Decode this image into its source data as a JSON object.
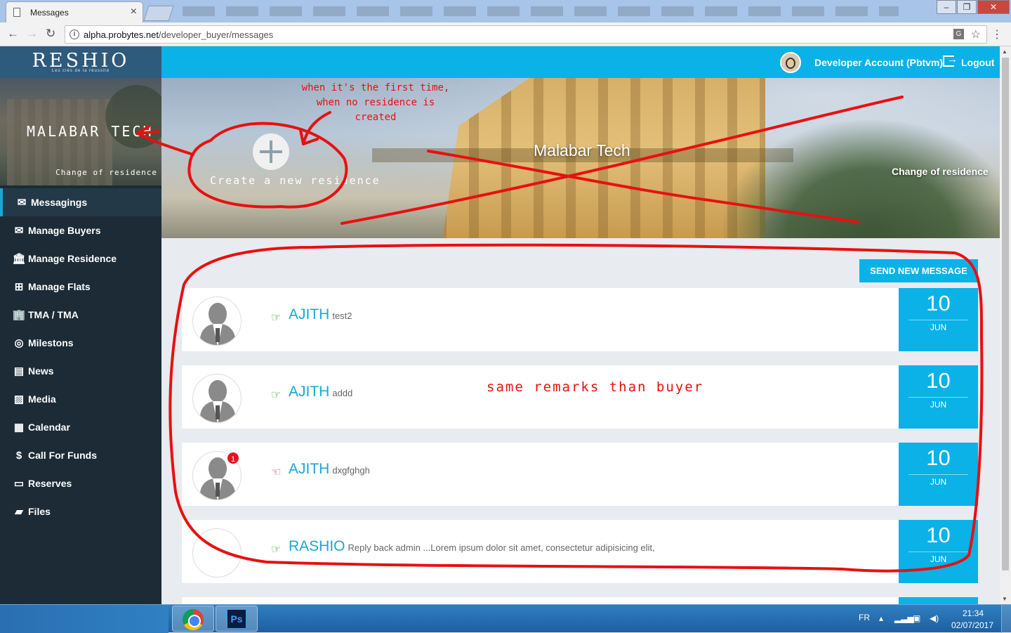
{
  "browser": {
    "tab_title": "Messages",
    "tab_close": "×",
    "url_domain": "alpha.probytes.net",
    "url_path": "/developer_buyer/messages",
    "win_minimize": "–",
    "win_restore": "❐",
    "win_close": "✕",
    "back": "←",
    "forward": "→",
    "reload": "↻",
    "star": "☆",
    "menu": "⋮",
    "translate": "G"
  },
  "sidebar": {
    "logo": "RESHIO",
    "tagline": "Les clés de la réussite",
    "residence_name": "MALABAR TECH",
    "change_residence": "Change of residence",
    "items": [
      {
        "label": "Messagings",
        "icon": "envelope-icon",
        "glyph": "✉",
        "active": true
      },
      {
        "label": "Manage Buyers",
        "icon": "envelope-icon",
        "glyph": "✉",
        "active": false
      },
      {
        "label": "Manage Residence",
        "icon": "bank-icon",
        "glyph": "🏛",
        "active": false
      },
      {
        "label": "Manage Flats",
        "icon": "grid-icon",
        "glyph": "⊞",
        "active": false
      },
      {
        "label": "TMA / TMA",
        "icon": "building-icon",
        "glyph": "🏢",
        "active": false
      },
      {
        "label": "Milestons",
        "icon": "target-icon",
        "glyph": "◎",
        "active": false
      },
      {
        "label": "News",
        "icon": "newspaper-icon",
        "glyph": "▤",
        "active": false
      },
      {
        "label": "Media",
        "icon": "image-icon",
        "glyph": "▨",
        "active": false
      },
      {
        "label": "Calendar",
        "icon": "calendar-icon",
        "glyph": "▦",
        "active": false
      },
      {
        "label": "Call For Funds",
        "icon": "money-icon",
        "glyph": "$",
        "active": false
      },
      {
        "label": "Reserves",
        "icon": "card-icon",
        "glyph": "▭",
        "active": false
      },
      {
        "label": "Files",
        "icon": "folder-icon",
        "glyph": "▰",
        "active": false
      }
    ]
  },
  "topbar": {
    "account_name": "Developer Account (Pbtvm)",
    "logout": "Logout"
  },
  "hero": {
    "title": "Malabar Tech",
    "change_residence": "Change of residence",
    "create_label": "Create a new residence"
  },
  "messages": {
    "send_button": "SEND NEW MESSAGE",
    "rows": [
      {
        "name": "AJITH",
        "snippet": "test2",
        "day": "10",
        "month": "JUN",
        "direction": "out",
        "badge": null
      },
      {
        "name": "AJITH",
        "snippet": "addd",
        "day": "10",
        "month": "JUN",
        "direction": "out",
        "badge": null
      },
      {
        "name": "AJITH",
        "snippet": "dxgfghgh",
        "day": "10",
        "month": "JUN",
        "direction": "in",
        "badge": "1"
      },
      {
        "name": "RASHIO",
        "snippet": "Reply back admin ...Lorem ipsum dolor sit amet, consectetur adipisicing elit,",
        "day": "10",
        "month": "JUN",
        "direction": "out",
        "badge": null
      }
    ]
  },
  "annotations": {
    "first_time_line1": "when it's the first time,",
    "first_time_line2": "when no residence is created",
    "remarks": "same remarks than buyer",
    "color": "#e81010"
  },
  "taskbar": {
    "ps_label": "Ps",
    "lang": "FR",
    "time": "21:34",
    "date": "02/07/2017"
  },
  "colors": {
    "accent": "#0ab2e8",
    "sidebar_bg": "#1c2b36",
    "link": "#1aa6d6",
    "badge": "#e8111c"
  }
}
